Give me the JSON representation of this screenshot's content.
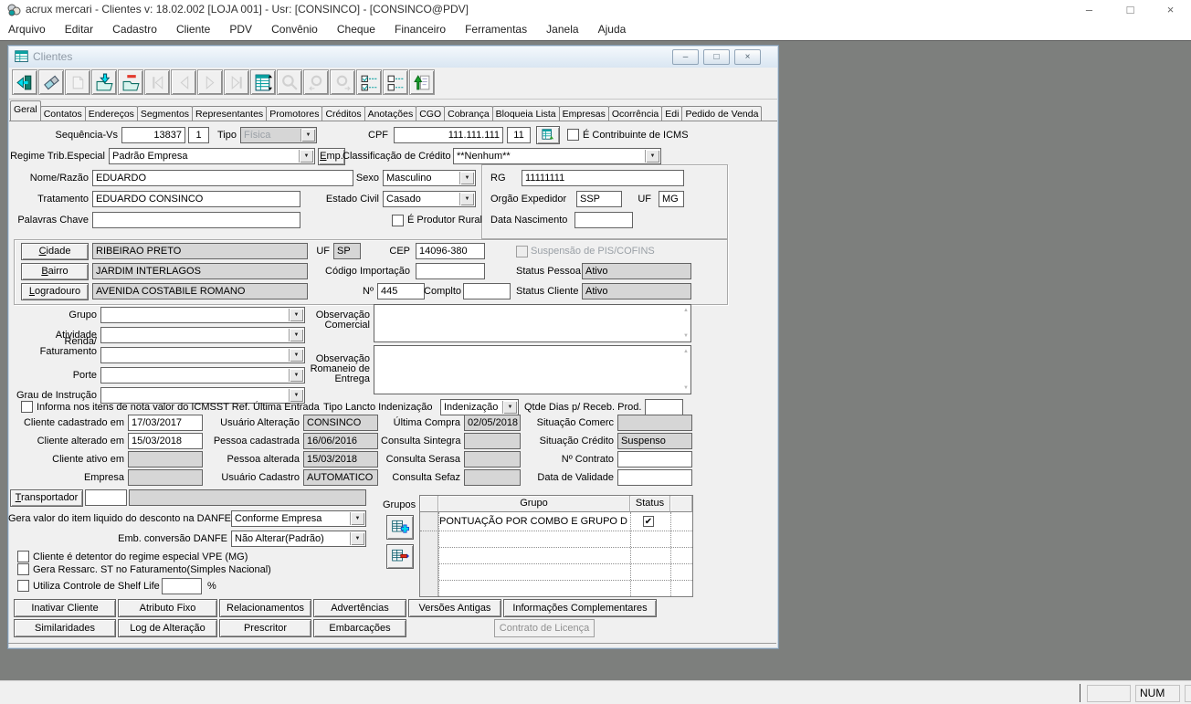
{
  "app": {
    "title": "acrux mercari - Clientes  v: 18.02.002   [LOJA 001] - Usr: [CONSINCO] - [CONSINCO@PDV]",
    "menu": [
      "Arquivo",
      "Editar",
      "Cadastro",
      "Cliente",
      "PDV",
      "Convênio",
      "Cheque",
      "Financeiro",
      "Ferramentas",
      "Janela",
      "Ajuda"
    ],
    "window_controls": {
      "minimize": "–",
      "restore": "□",
      "close": "×"
    }
  },
  "colors": {
    "mdi_background": "#7d7f7d",
    "icon_teal": "#0a8076",
    "icon_cyan": "#00dff0",
    "readonly_gray": "#d6d6d6",
    "status_red": "#e02818"
  },
  "child": {
    "title": "Clientes",
    "controls": {
      "minimize": "–",
      "restore": "□",
      "close": "×"
    },
    "toolbar_icons": [
      "exit-button",
      "erase-button",
      "insert-record-button",
      "save-record-button",
      "cancel-record-button",
      "first-record-button",
      "prior-record-button",
      "next-record-button",
      "last-record-button",
      "grid-view-button",
      "find-button",
      "find-prior-button",
      "find-next-button",
      "check-all-button",
      "uncheck-all-button",
      "submit-form-button"
    ],
    "tabs": [
      "Geral",
      "Contatos",
      "Endereços",
      "Segmentos",
      "Representantes",
      "Promotores",
      "Créditos",
      "Anotações",
      "CGO",
      "Cobrança",
      "Bloqueia Lista",
      "Empresas",
      "Ocorrência",
      "Edi",
      "Pedido de Venda"
    ],
    "active_tab": "Geral"
  },
  "form": {
    "sequencia": {
      "label": "Sequência-Vs",
      "value": "13837",
      "value2": "1"
    },
    "tipo": {
      "label": "Tipo",
      "value": "Física"
    },
    "cpf": {
      "label": "CPF",
      "value": "111.111.111",
      "digit": "11"
    },
    "contribuinte_icms": {
      "label": "É Contribuinte de ICMS",
      "checked": false
    },
    "regime": {
      "label": "Regime Trib.Especial",
      "value": "Padrão Empresa"
    },
    "emp_button": "Emp.",
    "classificacao": {
      "label": "Classificação de Crédito",
      "value": "**Nenhum**"
    },
    "nome": {
      "label": "Nome/Razão",
      "value": "EDUARDO"
    },
    "sexo": {
      "label": "Sexo",
      "value": "Masculino"
    },
    "rg": {
      "label": "RG",
      "value": "11111111"
    },
    "tratamento": {
      "label": "Tratamento",
      "value": "EDUARDO CONSINCO"
    },
    "estado_civil": {
      "label": "Estado Civil",
      "value": "Casado"
    },
    "orgao_expedidor": {
      "label": "Orgão Expedidor",
      "value": "SSP"
    },
    "uf_rg": {
      "label": "UF",
      "value": "MG"
    },
    "palavras_chave": {
      "label": "Palavras Chave",
      "value": ""
    },
    "produtor_rural": {
      "label": "É Produtor Rural",
      "checked": false
    },
    "data_nascimento": {
      "label": "Data Nascimento",
      "value": ""
    },
    "endereco": {
      "cidade_button": "Cidade",
      "cidade": "RIBEIRAO PRETO",
      "uf_label": "UF",
      "uf": "SP",
      "cep_label": "CEP",
      "cep": "14096-380",
      "bairro_button": "Bairro",
      "bairro": "JARDIM INTERLAGOS",
      "cod_importacao_label": "Código Importação",
      "cod_importacao": "",
      "logradouro_button": "Logradouro",
      "logradouro": "AVENIDA COSTABILE ROMANO",
      "numero_label": "Nº",
      "numero": "445",
      "complto_label": "Complto",
      "complto": ""
    },
    "suspensao_pis": {
      "label": "Suspensão de PIS/COFINS",
      "checked": false
    },
    "status_pessoa": {
      "label": "Status Pessoa",
      "value": "Ativo"
    },
    "status_cliente": {
      "label": "Status Cliente",
      "value": "Ativo"
    },
    "grupo": {
      "label": "Grupo",
      "value": ""
    },
    "atividade": {
      "label": "Atividade",
      "value": ""
    },
    "renda": {
      "label": "Renda/ Faturamento",
      "value": ""
    },
    "porte": {
      "label": "Porte",
      "value": ""
    },
    "grau_instrucao": {
      "label": "Grau de Instrução",
      "value": ""
    },
    "obs_comercial_label": "Observação Comercial",
    "obs_romaneio_label": "Observação Romaneio de Entrega",
    "icmsst": {
      "label": "Informa nos itens de nota valor do ICMSST Ref. Última Entrada",
      "checked": false
    },
    "tipo_lancto": {
      "label": "Tipo Lancto Indenização",
      "value": "Indenização"
    },
    "qtde_dias": {
      "label": "Qtde Dias p/ Receb. Prod.",
      "value": ""
    },
    "datas": {
      "cliente_cadastrado": {
        "label": "Cliente cadastrado em",
        "value": "17/03/2017"
      },
      "cliente_alterado": {
        "label": "Cliente alterado em",
        "value": "15/03/2018"
      },
      "cliente_ativo": {
        "label": "Cliente ativo em",
        "value": ""
      },
      "empresa": {
        "label": "Empresa",
        "value": ""
      },
      "usuario_alteracao": {
        "label": "Usuário Alteração",
        "value": "CONSINCO"
      },
      "pessoa_cadastrada": {
        "label": "Pessoa cadastrada",
        "value": "16/06/2016"
      },
      "pessoa_alterada": {
        "label": "Pessoa alterada",
        "value": "15/03/2018"
      },
      "usuario_cadastro": {
        "label": "Usuário Cadastro",
        "value": "AUTOMATICO"
      },
      "ultima_compra": {
        "label": "Última Compra",
        "value": "02/05/2018"
      },
      "consulta_sintegra": {
        "label": "Consulta Sintegra",
        "value": ""
      },
      "consulta_serasa": {
        "label": "Consulta Serasa",
        "value": ""
      },
      "consulta_sefaz": {
        "label": "Consulta Sefaz",
        "value": ""
      },
      "situacao_comerc": {
        "label": "Situação Comerc",
        "value": ""
      },
      "situacao_credito": {
        "label": "Situação Crédito",
        "value": "Suspenso"
      },
      "num_contrato": {
        "label": "Nº Contrato",
        "value": ""
      },
      "data_validade": {
        "label": "Data de Validade",
        "value": ""
      }
    },
    "transportador": {
      "button": "Transportador",
      "code": "",
      "name": ""
    },
    "danfe_desconto": {
      "label": "Gera valor do item liquido do desconto na DANFE",
      "value": "Conforme Empresa"
    },
    "danfe_conversao": {
      "label": "Emb. conversão DANFE",
      "value": "Não Alterar(Padrão)"
    },
    "vpe": {
      "label": "Cliente é detentor do regime especial VPE (MG)",
      "checked": false
    },
    "ressarc": {
      "label": "Gera Ressarc. ST no Faturamento(Simples Nacional)",
      "checked": false
    },
    "shelf_life": {
      "label": "Utiliza Controle de Shelf Life",
      "value": "",
      "suffix": "%",
      "checked": false
    },
    "grupos": {
      "label": "Grupos",
      "columns": {
        "grupo": "Grupo",
        "status": "Status"
      },
      "rows": [
        {
          "grupo": "PONTUAÇÃO POR COMBO E GRUPO D",
          "status": true
        }
      ]
    }
  },
  "actions": {
    "row1": [
      "Inativar Cliente",
      "Atributo Fixo",
      "Relacionamentos",
      "Advertências",
      "Versões Antigas",
      "Informações Complementares"
    ],
    "row2": [
      "Similaridades",
      "Log de Alteração",
      "Prescritor",
      "Embarcações",
      "Contrato de Licença"
    ]
  },
  "statusbar": {
    "num": "NUM"
  }
}
